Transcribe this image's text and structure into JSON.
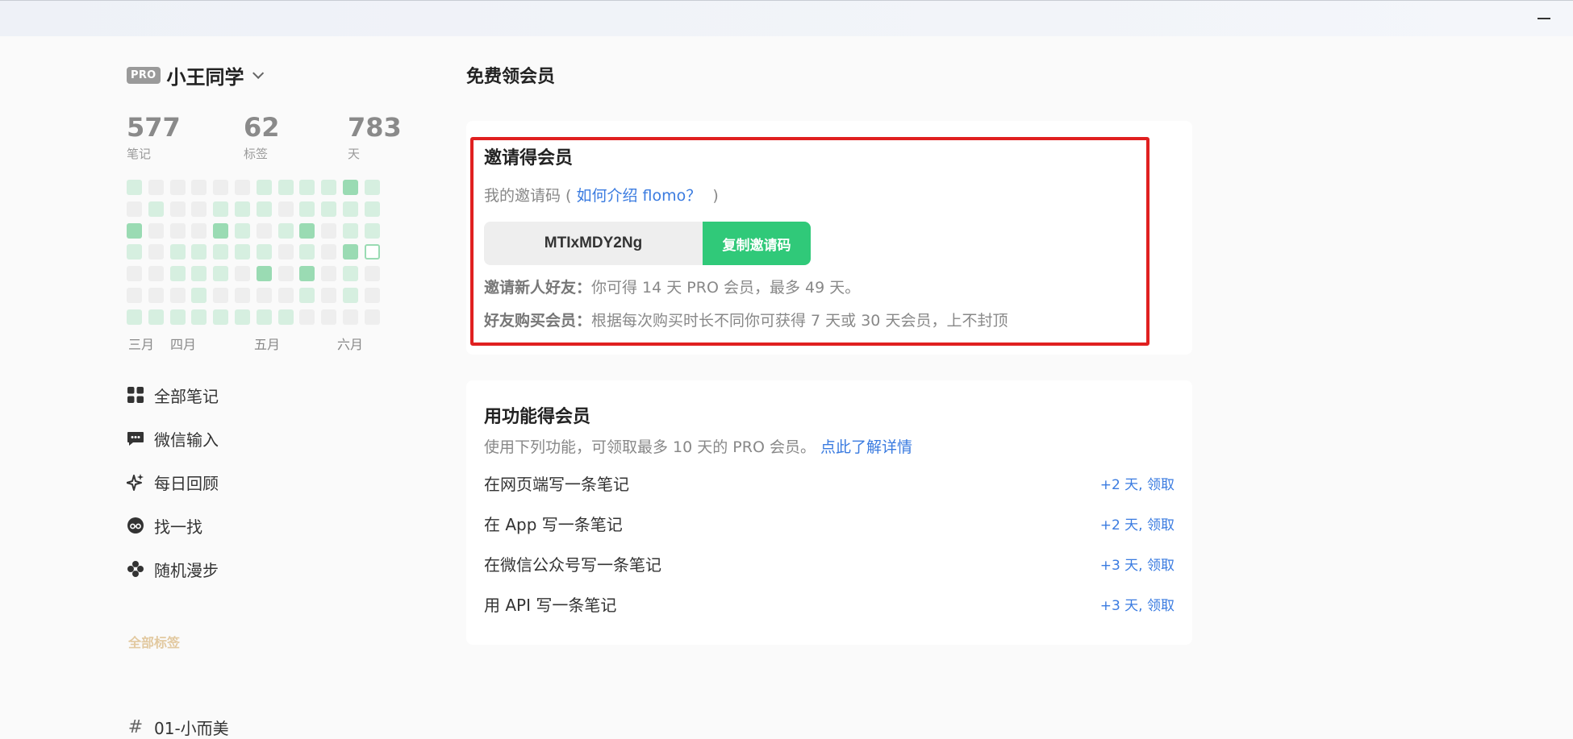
{
  "window": {
    "minimize_label": "—"
  },
  "user": {
    "badge": "PRO",
    "name": "小王同学"
  },
  "stats": [
    {
      "value": "577",
      "label": "笔记"
    },
    {
      "value": "62",
      "label": "标签"
    },
    {
      "value": "783",
      "label": "天"
    }
  ],
  "heatmap": {
    "rows": 7,
    "cols": 12,
    "levels": [
      [
        1,
        0,
        0,
        0,
        0,
        0,
        1,
        1,
        1,
        1,
        2,
        1
      ],
      [
        0,
        1,
        0,
        0,
        1,
        1,
        1,
        0,
        1,
        1,
        1,
        1
      ],
      [
        2,
        0,
        0,
        0,
        2,
        1,
        0,
        1,
        2,
        0,
        1,
        1
      ],
      [
        1,
        0,
        1,
        1,
        1,
        1,
        1,
        0,
        1,
        0,
        2,
        3
      ],
      [
        0,
        0,
        1,
        1,
        1,
        0,
        2,
        0,
        2,
        0,
        1,
        0
      ],
      [
        0,
        0,
        0,
        1,
        0,
        0,
        0,
        0,
        1,
        0,
        1,
        0
      ],
      [
        1,
        1,
        1,
        1,
        1,
        1,
        1,
        1,
        0,
        0,
        0,
        0
      ]
    ],
    "colors": {
      "empty": "#eeeeee",
      "light": "#d6efe0",
      "medium": "#9adbb3",
      "today_border": "#9adbb3"
    },
    "months": [
      "三月",
      "四月",
      "五月",
      "六月"
    ]
  },
  "nav": [
    {
      "label": "全部笔记",
      "icon": "grid-icon"
    },
    {
      "label": "微信输入",
      "icon": "chat-icon"
    },
    {
      "label": "每日回顾",
      "icon": "sparkle-icon"
    },
    {
      "label": "找一找",
      "icon": "glasses-icon"
    },
    {
      "label": "随机漫步",
      "icon": "flower-icon"
    }
  ],
  "tags": {
    "section_label": "全部标签",
    "items": [
      {
        "label": "01-小而美"
      }
    ]
  },
  "main": {
    "title": "免费领会员",
    "invite": {
      "title": "邀请得会员",
      "code_prefix": "我的邀请码 (",
      "code_link": "如何介绍 flomo？",
      "code_suffix": ")",
      "code": "MTIxMDY2Ng",
      "copy_button": "复制邀请码",
      "rule1_label": "邀请新人好友：",
      "rule1_text": "你可得 14 天 PRO 会员，最多 49 天。",
      "rule2_label": "好友购买会员：",
      "rule2_text": "根据每次购买时长不同你可获得 7 天或 30 天会员，上不封顶"
    },
    "feature": {
      "title": "用功能得会员",
      "desc": "使用下列功能，可领取最多 10 天的 PRO 会员。",
      "desc_link": "点此了解详情",
      "tasks": [
        {
          "label": "在网页端写一条笔记",
          "claim": "+2 天, 领取"
        },
        {
          "label": "在 App 写一条笔记",
          "claim": "+2 天, 领取"
        },
        {
          "label": "在微信公众号写一条笔记",
          "claim": "+3 天, 领取"
        },
        {
          "label": "用 API 写一条笔记",
          "claim": "+3 天, 领取"
        }
      ]
    }
  },
  "colors": {
    "accent_green": "#30c979",
    "link_blue": "#3a7be0",
    "highlight_red": "#e02020"
  }
}
